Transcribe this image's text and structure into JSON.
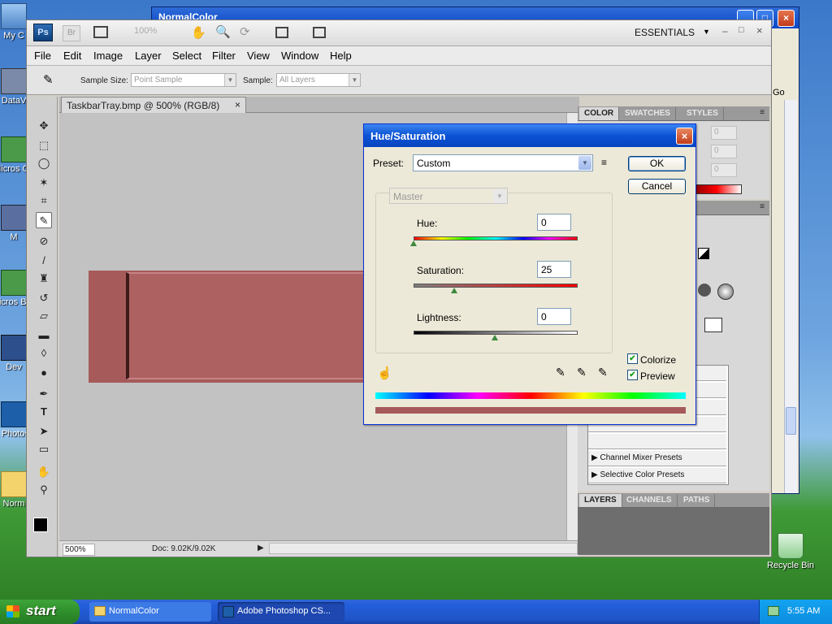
{
  "desktop": {
    "icons": [
      {
        "label": "My C",
        "icon": "my-computer-icon"
      },
      {
        "label": "DataV",
        "icon": "datavault-icon"
      },
      {
        "label": "Micros C+",
        "icon": "microsoft-cpp-icon"
      },
      {
        "label": "M",
        "icon": "m-icon"
      },
      {
        "label": "Micros Bas",
        "icon": "microsoft-basic-icon"
      },
      {
        "label": "Dev",
        "icon": "dev-icon"
      },
      {
        "label": "A Photosh",
        "icon": "photoshop-shortcut-icon"
      },
      {
        "label": "Norm",
        "icon": "folder-icon"
      },
      {
        "label": "Recycle Bin",
        "icon": "recycle-bin-icon"
      }
    ]
  },
  "bg_window": {
    "title": "NormalColor",
    "side_text": "Go"
  },
  "photoshop": {
    "logo": "Ps",
    "bridge": "Br",
    "zoom": "100%",
    "workspace": "ESSENTIALS",
    "menu": [
      "File",
      "Edit",
      "Image",
      "Layer",
      "Select",
      "Filter",
      "View",
      "Window",
      "Help"
    ],
    "options": {
      "sample_size_label": "Sample Size:",
      "sample_size_value": "Point Sample",
      "sample_label": "Sample:",
      "sample_value": "All Layers"
    },
    "document": {
      "tab_title": "TaskbarTray.bmp @ 500% (RGB/8)",
      "status_zoom": "500%",
      "status_doc": "Doc: 9.02K/9.02K",
      "image_color": "#a65a5a"
    },
    "panels": {
      "color_tabs": [
        "COLOR",
        "SWATCHES",
        "STYLES"
      ],
      "color_values": [
        "0",
        "0",
        "0"
      ],
      "presets": [
        "Channel Mixer Presets",
        "Selective Color Presets"
      ],
      "layers_tabs": [
        "LAYERS",
        "CHANNELS",
        "PATHS"
      ]
    }
  },
  "dialog": {
    "title": "Hue/Saturation",
    "preset_label": "Preset:",
    "preset_value": "Custom",
    "channel_value": "Master",
    "ok_label": "OK",
    "cancel_label": "Cancel",
    "hue_label": "Hue:",
    "hue_value": "0",
    "saturation_label": "Saturation:",
    "saturation_value": "25",
    "lightness_label": "Lightness:",
    "lightness_value": "0",
    "colorize_label": "Colorize",
    "colorize_checked": true,
    "preview_label": "Preview",
    "preview_checked": true,
    "colorize_color": "#a65a5a"
  },
  "taskbar": {
    "start_label": "start",
    "tasks": [
      "NormalColor",
      "Adobe Photoshop CS..."
    ],
    "clock": "5:55 AM"
  }
}
